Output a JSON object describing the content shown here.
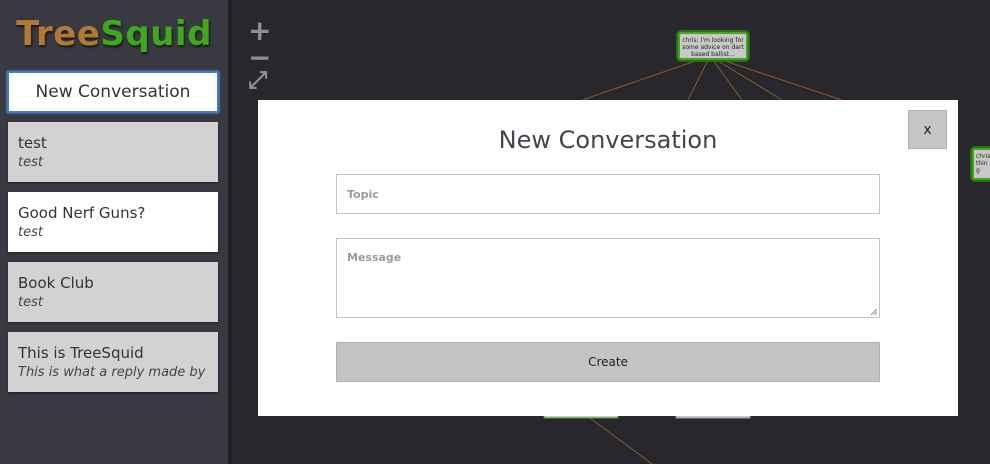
{
  "app": {
    "logo_part1": "Tree",
    "logo_part2": "Squid",
    "colors": {
      "logo_tree": "#b07a35",
      "logo_squid": "#3fa81b",
      "accent": "#3a7bd5",
      "node_border": "#3fa81b",
      "edge": "#8a5a2e"
    }
  },
  "sidebar": {
    "new_conversation_label": "New Conversation",
    "conversations": [
      {
        "title": "test",
        "subtitle": "test",
        "active": false
      },
      {
        "title": "Good Nerf Guns?",
        "subtitle": "test",
        "active": true
      },
      {
        "title": "Book Club",
        "subtitle": "test",
        "active": false
      },
      {
        "title": "This is TreeSquid",
        "subtitle": "This is what a reply made by",
        "active": false
      }
    ]
  },
  "canvas": {
    "zoom_in": "+",
    "zoom_out": "−",
    "fullscreen": "⤢",
    "nodes": [
      {
        "text": "chris: I'm looking for some advice on dart based ballist..."
      },
      {
        "text": "chris thin g"
      }
    ]
  },
  "modal": {
    "title": "New Conversation",
    "close_label": "x",
    "topic_placeholder": "Topic",
    "message_placeholder": "Message",
    "create_label": "Create"
  }
}
